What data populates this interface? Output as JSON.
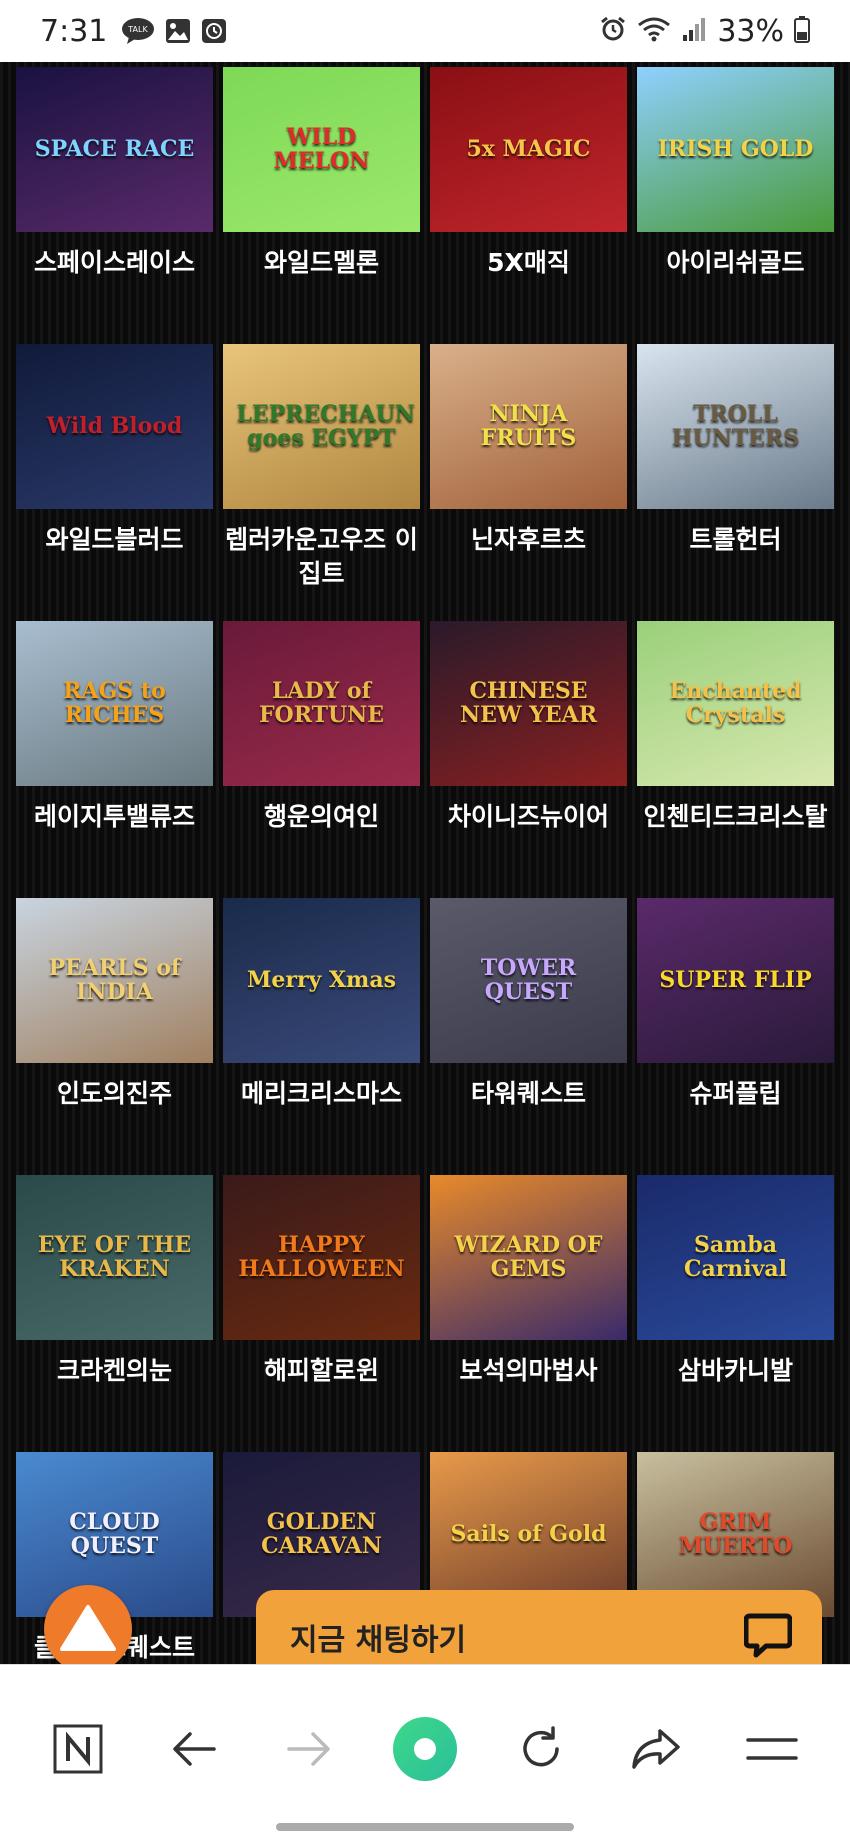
{
  "status_bar": {
    "time": "7:31",
    "battery": "33%"
  },
  "games": [
    {
      "name": "스페이스레이스",
      "logo": "SPACE RACE",
      "bg": "#1a1240",
      "bg2": "#5a2a6a",
      "logo_color": "#7fd4ff"
    },
    {
      "name": "와일드멜론",
      "logo": "WILD MELON",
      "bg": "#7ed957",
      "bg2": "#9be86a",
      "logo_color": "#e02b2b"
    },
    {
      "name": "5X매직",
      "logo": "5x MAGIC",
      "bg": "#8a0f14",
      "bg2": "#c0262b",
      "logo_color": "#f6c64a"
    },
    {
      "name": "아이리쉬골드",
      "logo": "IRISH GOLD",
      "bg": "#8fd0ff",
      "bg2": "#4a9a3a",
      "logo_color": "#f3d24a"
    },
    {
      "name": "와일드블러드",
      "logo": "Wild Blood",
      "bg": "#101a3a",
      "bg2": "#2a3a6a",
      "logo_color": "#c0202a"
    },
    {
      "name": "렙러카운고우즈 이집트",
      "logo": "LEPRECHAUN goes EGYPT",
      "bg": "#e8c57a",
      "bg2": "#b08640",
      "logo_color": "#2e7a2a"
    },
    {
      "name": "닌자후르츠",
      "logo": "NINJA FRUITS",
      "bg": "#d9b08a",
      "bg2": "#a0603a",
      "logo_color": "#f1e04a"
    },
    {
      "name": "트롤헌터",
      "logo": "TROLL HUNTERS",
      "bg": "#d8e4ee",
      "bg2": "#6a7a8a",
      "logo_color": "#6a5a40"
    },
    {
      "name": "레이지투밸류즈",
      "logo": "RAGS to RICHES",
      "bg": "#a8bdd0",
      "bg2": "#6a7a80",
      "logo_color": "#f4a21a"
    },
    {
      "name": "행운의여인",
      "logo": "LADY of FORTUNE",
      "bg": "#6a1a3a",
      "bg2": "#9a2a4a",
      "logo_color": "#e8b84a"
    },
    {
      "name": "차이니즈뉴이어",
      "logo": "CHINESE NEW YEAR",
      "bg": "#2a1a2a",
      "bg2": "#8a2020",
      "logo_color": "#f3c24a"
    },
    {
      "name": "인첸티드크리스탈",
      "logo": "Enchanted Crystals",
      "bg": "#9ad07a",
      "bg2": "#d8e8b0",
      "logo_color": "#f3c24a"
    },
    {
      "name": "인도의진주",
      "logo": "PEARLS of INDIA",
      "bg": "#c8d4e0",
      "bg2": "#a08060",
      "logo_color": "#f0d070"
    },
    {
      "name": "메리크리스마스",
      "logo": "Merry Xmas",
      "bg": "#1a2a4a",
      "bg2": "#3a4a7a",
      "logo_color": "#f3d24a"
    },
    {
      "name": "타워퀘스트",
      "logo": "TOWER QUEST",
      "bg": "#5a5a6a",
      "bg2": "#3a3a4a",
      "logo_color": "#c8a8ff"
    },
    {
      "name": "슈퍼플립",
      "logo": "SUPER FLIP",
      "bg": "#5a2a6a",
      "bg2": "#2a1a3a",
      "logo_color": "#f8d82a"
    },
    {
      "name": "크라켄의눈",
      "logo": "EYE OF THE KRAKEN",
      "bg": "#2a4a4a",
      "bg2": "#4a6a6a",
      "logo_color": "#e8b84a"
    },
    {
      "name": "해피할로윈",
      "logo": "HAPPY HALLOWEEN",
      "bg": "#3a1a1a",
      "bg2": "#6a2a10",
      "logo_color": "#f07a1a"
    },
    {
      "name": "보석의마법사",
      "logo": "WIZARD OF GEMS",
      "bg": "#e88a2a",
      "bg2": "#3a2a6a",
      "logo_color": "#f3d24a"
    },
    {
      "name": "삼바카니발",
      "logo": "Samba Carnival",
      "bg": "#1a2a6a",
      "bg2": "#2a4a9a",
      "logo_color": "#f3d24a"
    },
    {
      "name": "클라우드퀘스트",
      "logo": "CLOUD QUEST",
      "bg": "#4a8ad0",
      "bg2": "#2a4a8a",
      "logo_color": "#f0f0ff"
    },
    {
      "name": "",
      "logo": "GOLDEN CARAVAN",
      "bg": "#1a1a3a",
      "bg2": "#3a2a4a",
      "logo_color": "#f3c24a"
    },
    {
      "name": "",
      "logo": "Sails of Gold",
      "bg": "#e89a4a",
      "bg2": "#6a3a2a",
      "logo_color": "#f3d24a"
    },
    {
      "name": "",
      "logo": "GRIM MUERTO",
      "bg": "#c8c0a0",
      "bg2": "#6a4a30",
      "logo_color": "#e04a2a"
    }
  ],
  "chat_button": {
    "label": "지금 채팅하기"
  },
  "colors": {
    "accent_orange": "#ee7a2a",
    "chat_bar": "#f2a23b"
  },
  "icons": [
    "naver-n-icon",
    "back-arrow-icon",
    "forward-arrow-icon",
    "home-green-icon",
    "reload-icon",
    "share-icon",
    "menu-icon",
    "chat-bubble-icon",
    "up-triangle-icon"
  ]
}
